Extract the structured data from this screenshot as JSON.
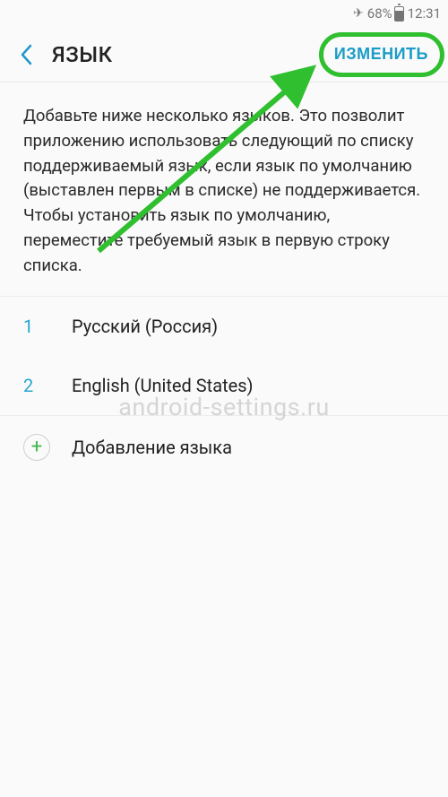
{
  "status": {
    "airplane_icon": "✈",
    "battery_pct": "68%",
    "time": "12:31"
  },
  "header": {
    "title": "ЯЗЫК",
    "edit_label": "ИЗМЕНИТЬ"
  },
  "description": "Добавьте ниже несколько языков. Это позволит приложению использовать следующий по списку поддерживаемый язык, если язык по умолчанию (выставлен первым в списке) не поддерживается. Чтобы установить язык по умолчанию, переместите требуемый язык в первую строку списка.",
  "languages": [
    {
      "index": "1",
      "name": "Русский (Россия)"
    },
    {
      "index": "2",
      "name": "English (United States)"
    }
  ],
  "add_label": "Добавление языка",
  "watermark": "android-settings.ru"
}
